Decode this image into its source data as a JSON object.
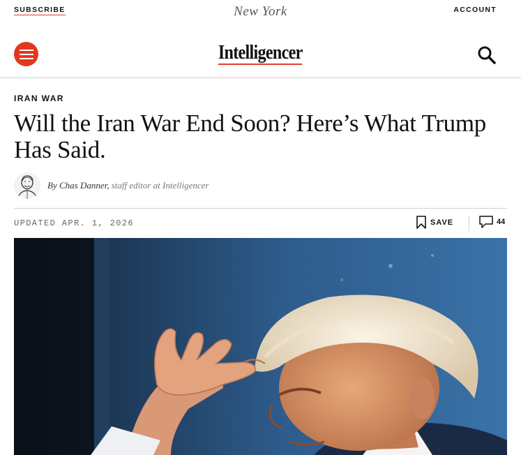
{
  "topbar": {
    "subscribe_label": "SUBSCRIBE",
    "site_logo": "New York",
    "account_label": "ACCOUNT"
  },
  "navbar": {
    "brand": "Intelligencer",
    "menu_icon": "hamburger-menu-icon",
    "search_icon": "search-icon",
    "accent_color": "#e2371e"
  },
  "article": {
    "rubric": "IRAN WAR",
    "headline": "Will the Iran War End Soon? Here’s What Trump Has Said.",
    "byline": {
      "prefix": "By",
      "author": "Chas Danner",
      "role": "staff editor at Intelligencer"
    },
    "updated": "UPDATED APR. 1, 2026",
    "save_label": "SAVE",
    "comment_count": "44"
  },
  "hero_image": {
    "icon": "photo-of-trump-saluting"
  }
}
